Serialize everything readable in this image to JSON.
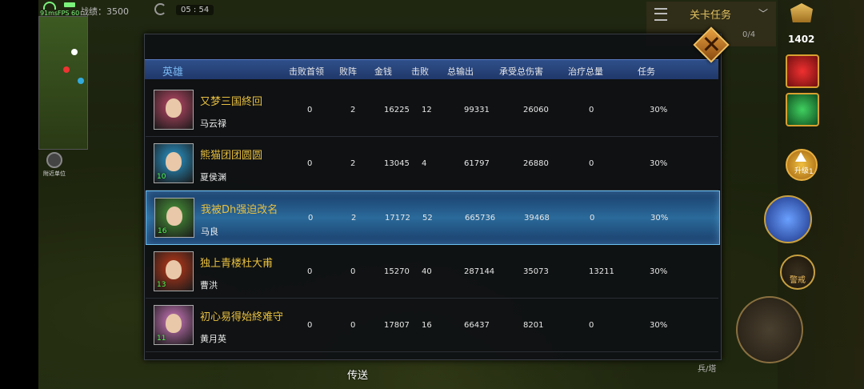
{
  "status_bar": {
    "ping": "91ms",
    "fps": "FPS 60",
    "score": "战绩：3500",
    "clock": "05 : 54"
  },
  "minimap": {
    "nearby_label": "附近单位"
  },
  "quest_tracker": {
    "title": "关卡任务",
    "progress": "0/4"
  },
  "rank": {
    "value": "1402"
  },
  "buttons": {
    "level_up": "升级",
    "level_up_count": "1",
    "alert": "警戒",
    "teleport": "传送",
    "soldier": "兵/塔"
  },
  "columns": [
    "英雄",
    "击败首领",
    "败阵",
    "金钱",
    "击败",
    "总输出",
    "承受总伤害",
    "治疗总量",
    "任务"
  ],
  "rows": [
    {
      "player": "又梦三国終回",
      "hero": "马云禄",
      "level": "",
      "boss_kills": "0",
      "deaths": "2",
      "gold": "16225",
      "kills": "12",
      "damage_dealt": "99331",
      "damage_taken": "26060",
      "healing": "0",
      "task": "30%",
      "selected": false,
      "color": "#c04a6a"
    },
    {
      "player": "熊猫团团圆圆",
      "hero": "夏侯渊",
      "level": "10",
      "boss_kills": "0",
      "deaths": "2",
      "gold": "13045",
      "kills": "4",
      "damage_dealt": "61797",
      "damage_taken": "26880",
      "healing": "0",
      "task": "30%",
      "selected": false,
      "color": "#2a9ad0"
    },
    {
      "player": "我被Dh强迫改名",
      "hero": "马良",
      "level": "16",
      "boss_kills": "0",
      "deaths": "2",
      "gold": "17172",
      "kills": "52",
      "damage_dealt": "665736",
      "damage_taken": "39468",
      "healing": "0",
      "task": "30%",
      "selected": true,
      "color": "#4a9a3a"
    },
    {
      "player": "独上青楼杜大甫",
      "hero": "曹洪",
      "level": "13",
      "boss_kills": "0",
      "deaths": "0",
      "gold": "15270",
      "kills": "40",
      "damage_dealt": "287144",
      "damage_taken": "35073",
      "healing": "13211",
      "task": "30%",
      "selected": false,
      "color": "#c03a1a"
    },
    {
      "player": "初心易得始終难守",
      "hero": "黄月英",
      "level": "11",
      "boss_kills": "0",
      "deaths": "0",
      "gold": "17807",
      "kills": "16",
      "damage_dealt": "66437",
      "damage_taken": "8201",
      "healing": "0",
      "task": "30%",
      "selected": false,
      "color": "#d07ac0"
    }
  ]
}
